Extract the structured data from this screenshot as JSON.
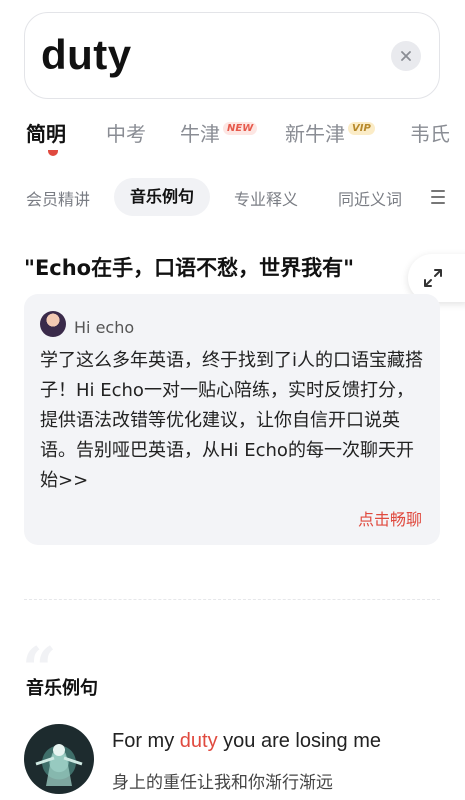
{
  "search": {
    "word": "duty"
  },
  "dict_tabs": [
    {
      "label": "简明",
      "active": true
    },
    {
      "label": "中考",
      "active": false
    },
    {
      "label": "牛津",
      "tag": "NEW",
      "active": false
    },
    {
      "label": "新牛津",
      "tag": "VIP",
      "active": false
    },
    {
      "label": "韦氏",
      "active": false
    }
  ],
  "sub_tabs": [
    {
      "label": "会员精讲",
      "active": false
    },
    {
      "label": "音乐例句",
      "active": true
    },
    {
      "label": "专业释义",
      "active": false
    },
    {
      "label": "同近义词",
      "active": false
    }
  ],
  "promo": {
    "title": "\"Echo在手，口语不愁，世界我有\"",
    "name": "Hi echo",
    "body": "学了这么多年英语，终于找到了i人的口语宝藏搭子！Hi Echo一对一贴心陪练，实时反馈打分，提供语法改错等优化建议，让你自信开口说英语。告别哑巴英语，从Hi Echo的每一次聊天开始>>",
    "cta": "点击畅聊"
  },
  "music": {
    "section_title": "音乐例句",
    "example": {
      "en_before": "For my ",
      "en_highlight": "duty",
      "en_after": " you are losing me",
      "zh": "身上的重任让我和你渐行渐远"
    }
  },
  "colors": {
    "accent": "#e04a3f",
    "card_bg": "#f3f4f7",
    "muted_text": "#8a8d94"
  },
  "icons": {
    "clear": "close-icon",
    "expand": "expand-arrows-icon",
    "menu": "menu-lines-icon"
  }
}
